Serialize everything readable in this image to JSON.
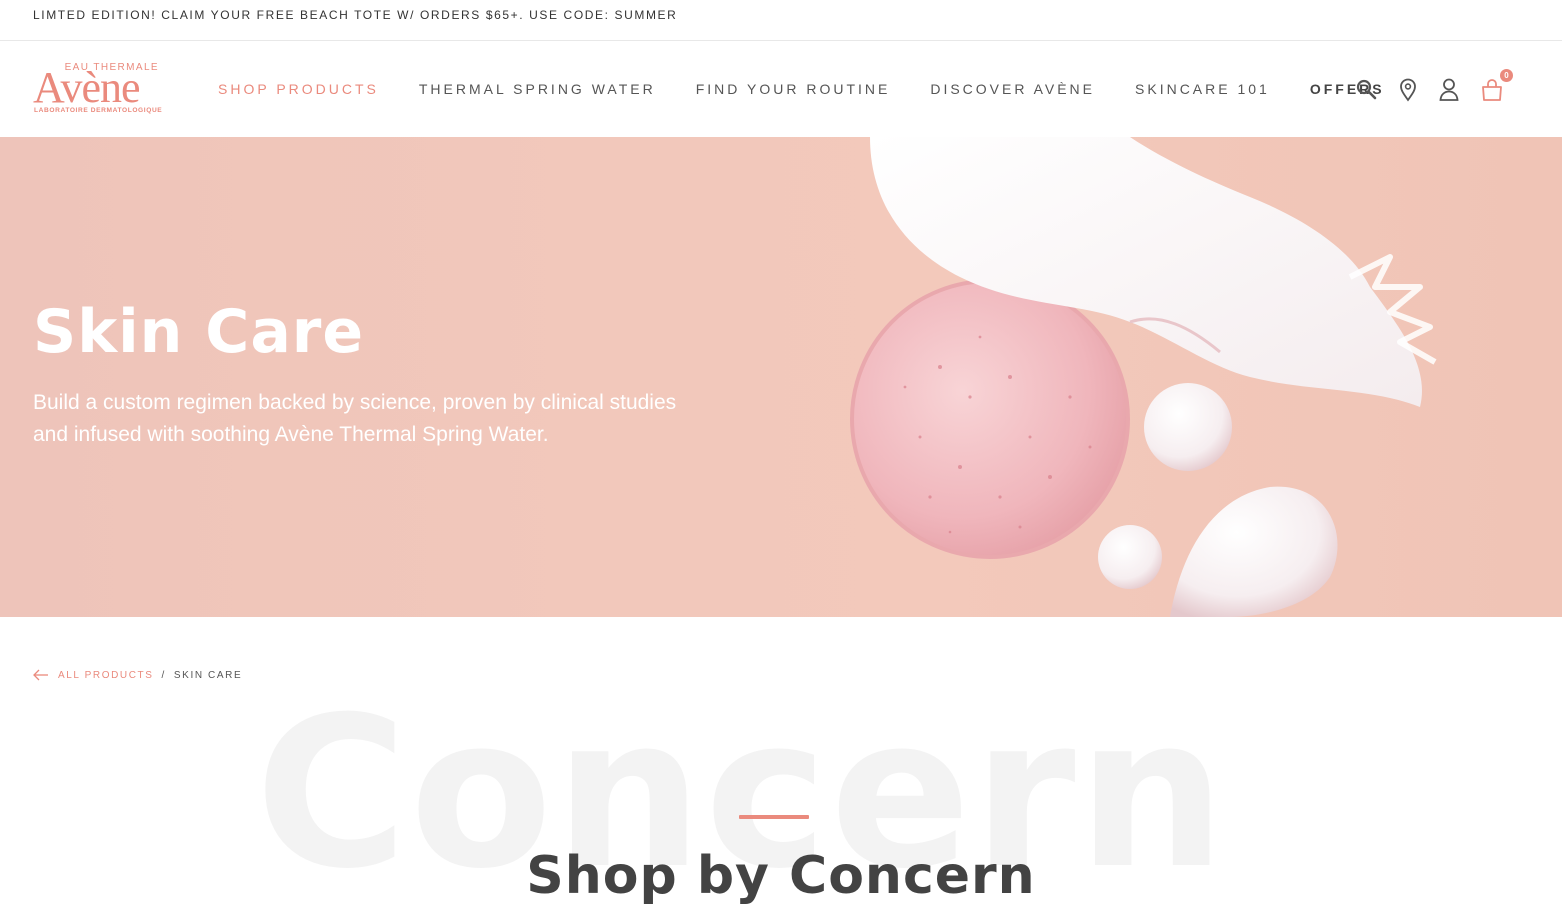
{
  "announcement": {
    "text": "LIMTED EDITION! CLAIM YOUR FREE BEACH TOTE W/ ORDERS $65+. USE CODE: SUMMER"
  },
  "logo": {
    "top": "EAU THERMALE",
    "main": "Avène",
    "sub": "LABORATOIRE DERMATOLOGIQUE"
  },
  "nav": {
    "items": [
      {
        "label": "SHOP PRODUCTS"
      },
      {
        "label": "THERMAL SPRING WATER"
      },
      {
        "label": "FIND YOUR ROUTINE"
      },
      {
        "label": "DISCOVER AVÈNE"
      },
      {
        "label": "SKINCARE 101"
      },
      {
        "label": "OFFERS"
      }
    ]
  },
  "header_icons": {
    "search": "search-icon",
    "location": "location-pin-icon",
    "account": "user-icon",
    "cart": "shopping-bag-icon",
    "cart_count": "0"
  },
  "hero": {
    "title": "Skin Care",
    "description": "Build a custom regimen backed by science, proven by clinical studies and infused with soothing Avène Thermal Spring Water."
  },
  "breadcrumb": {
    "parent": "ALL PRODUCTS",
    "separator": "/",
    "current": "SKIN CARE"
  },
  "concern": {
    "background_word": "Concern",
    "title": "Shop by Concern"
  },
  "colors": {
    "brand": "#ea8a7d",
    "hero_bg": "#f2c8bb",
    "text": "#3d3d3d"
  }
}
